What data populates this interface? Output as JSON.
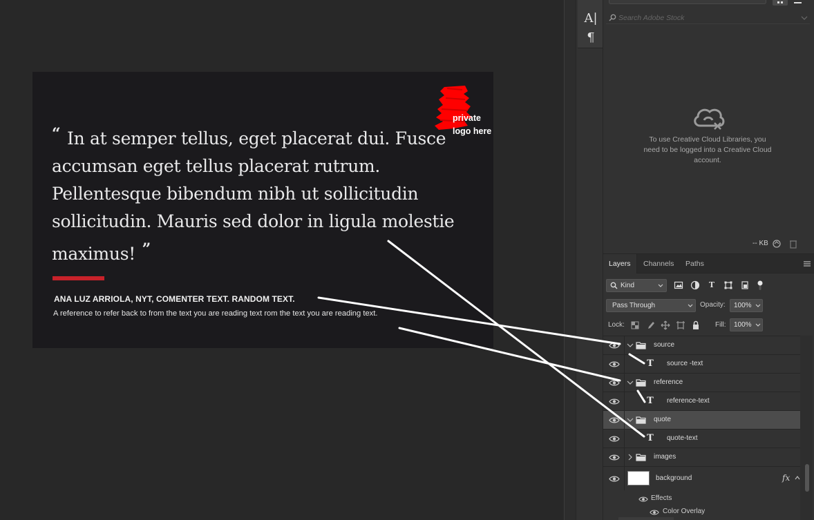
{
  "artboard": {
    "quote_open": "“",
    "quote_close": "”",
    "quote_body": "In at semper tellus, eget placerat dui. Fusce accumsan eget tellus placerat rutrum. Pellentesque bibendum nibh ut sollicitudin sollicitudin. Mauris sed dolor in ligula molestie maximus!",
    "source_text": "ANA LUZ ARRIOLA, NYT, COMENTER TEXT. RANDOM TEXT.",
    "reference_text": "A reference to refer back to from the text you are reading text rom the text you are reading text.",
    "logo_placeholder": "private\nlogo here",
    "accent_color": "#c8222a"
  },
  "tool_strip": {
    "tools": [
      {
        "icon": "character-panel-icon",
        "glyph": "A|"
      },
      {
        "icon": "paragraph-panel-icon",
        "glyph": "¶"
      }
    ]
  },
  "libraries": {
    "stock_search_placeholder": "Search Adobe Stock",
    "cc_message": "To use Creative Cloud Libraries, you need to be logged into a Creative Cloud account.",
    "status_size": "-- KB"
  },
  "layers_panel": {
    "tabs": [
      {
        "label": "Layers",
        "active": true
      },
      {
        "label": "Channels",
        "active": false
      },
      {
        "label": "Paths",
        "active": false
      }
    ],
    "filter_kind": "Kind",
    "blend_mode": "Pass Through",
    "opacity_label": "Opacity:",
    "opacity_value": "100%",
    "lock_label": "Lock:",
    "fill_label": "Fill:",
    "fill_value": "100%",
    "layers": [
      {
        "name": "source",
        "kind": "group",
        "expanded": true,
        "selected": false
      },
      {
        "name": "source -text",
        "kind": "text",
        "selected": false
      },
      {
        "name": "reference",
        "kind": "group",
        "expanded": true,
        "selected": false
      },
      {
        "name": "reference-text",
        "kind": "text",
        "selected": false
      },
      {
        "name": "quote",
        "kind": "group",
        "expanded": true,
        "selected": true
      },
      {
        "name": "quote-text",
        "kind": "text",
        "selected": false
      },
      {
        "name": "images",
        "kind": "group",
        "expanded": false,
        "selected": false
      },
      {
        "name": "background",
        "kind": "pixel",
        "has_fx": true,
        "selected": false
      }
    ],
    "effects_label": "Effects",
    "color_overlay_label": "Color Overlay",
    "fx_glyph": "fx"
  }
}
